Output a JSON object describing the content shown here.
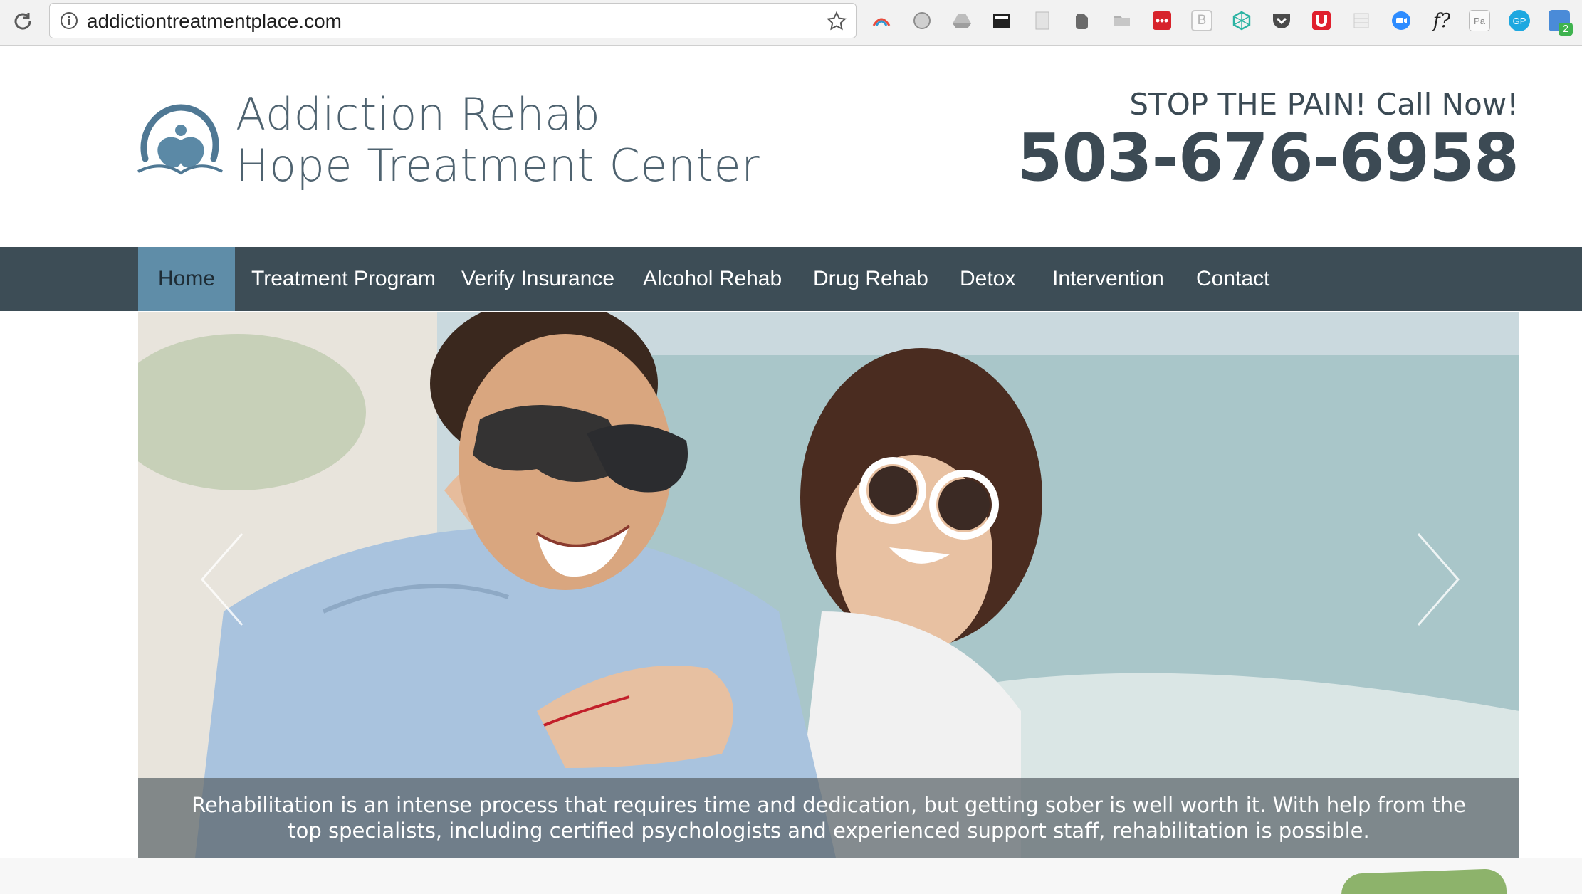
{
  "browser": {
    "url": "addictiontreatmentplace.com",
    "extensions": [
      {
        "icon": "rainbow-arc-icon",
        "label": ""
      },
      {
        "icon": "grey-circle-icon",
        "label": ""
      },
      {
        "icon": "drive-icon",
        "label": ""
      },
      {
        "icon": "clapper-icon",
        "label": ""
      },
      {
        "icon": "page-icon",
        "label": ""
      },
      {
        "icon": "evernote-icon",
        "label": ""
      },
      {
        "icon": "folder-icon",
        "label": ""
      },
      {
        "icon": "red-dots-icon",
        "label": ""
      },
      {
        "icon": "b-icon",
        "label": "B"
      },
      {
        "icon": "crystal-icon",
        "label": ""
      },
      {
        "icon": "pocket-icon",
        "label": ""
      },
      {
        "icon": "u-magnet-icon",
        "label": ""
      },
      {
        "icon": "grey-grid-icon",
        "label": ""
      },
      {
        "icon": "zoom-icon",
        "label": ""
      },
      {
        "icon": "font-question-icon",
        "label": "f?"
      },
      {
        "icon": "pa-cursor-icon",
        "label": "Pa"
      },
      {
        "icon": "gp-icon",
        "label": "GP"
      },
      {
        "icon": "code-badge-icon",
        "label": "2"
      }
    ]
  },
  "site": {
    "logo_line1": "Addiction Rehab",
    "logo_line2": "Hope Treatment Center",
    "cta": "STOP THE PAIN! Call Now!",
    "phone": "503-676-6958"
  },
  "nav": {
    "items": [
      "Home",
      "Treatment Program",
      "Verify Insurance",
      "Alcohol Rehab",
      "Drug Rehab",
      "Detox",
      "Intervention",
      "Contact"
    ],
    "active": "Home"
  },
  "hero": {
    "caption": "Rehabilitation is an intense process that requires time and dedication, but getting sober is well worth it. With help from the top specialists, including certified psychologists and experienced support staff, rehabilitation is possible."
  },
  "colors": {
    "nav_bg": "#3d4d56",
    "nav_active": "#5f8da8",
    "text_dark": "#3c4a54",
    "accent_green": "#8db36b"
  }
}
